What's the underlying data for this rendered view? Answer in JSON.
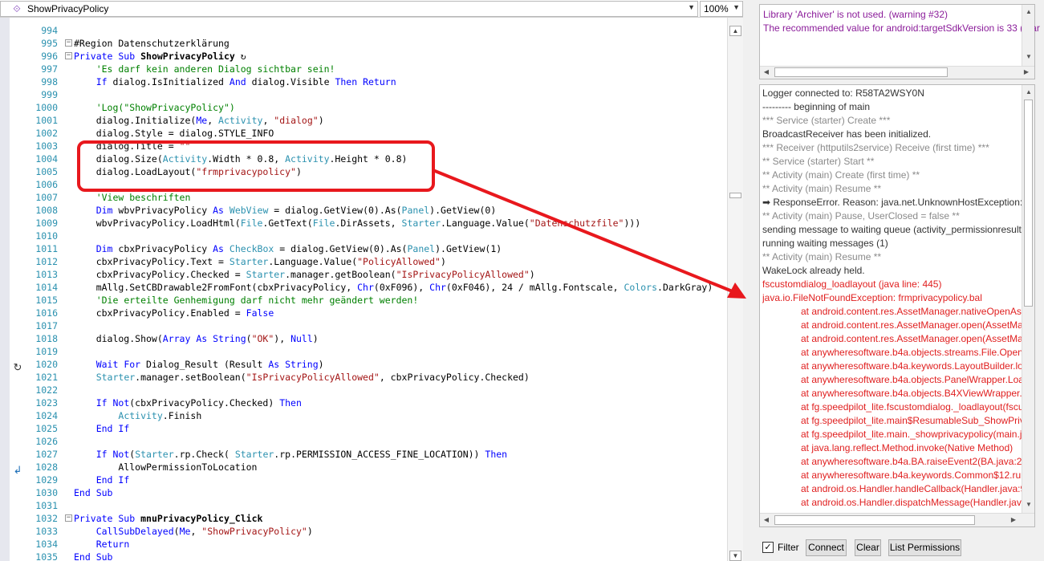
{
  "editor": {
    "sub_selector": "ShowPrivacyPolicy",
    "zoom": "100%",
    "code_lines": [
      {
        "n": "994",
        "h": ""
      },
      {
        "n": "995",
        "h": "#Region Datenschutzerklärung"
      },
      {
        "n": "996",
        "h": "<span class=\"k\">Private Sub</span> <span class=\"b\">ShowPrivacyPolicy</span>"
      },
      {
        "n": "997",
        "h": "    <span class=\"c\">'Es darf kein anderen Dialog sichtbar sein!</span>"
      },
      {
        "n": "998",
        "h": "    <span class=\"k\">If</span> dialog.IsInitialized <span class=\"k\">And</span> dialog.Visible <span class=\"k\">Then Return</span>"
      },
      {
        "n": "999",
        "h": ""
      },
      {
        "n": "1000",
        "h": "    <span class=\"c\">'Log(\"ShowPrivacyPolicy\")</span>"
      },
      {
        "n": "1001",
        "h": "    dialog.Initialize(<span class=\"k\">Me</span>, <span class=\"t\">Activity</span>, <span class=\"s\">\"dialog\"</span>)"
      },
      {
        "n": "1002",
        "h": "    dialog.Style = dialog.STYLE_INFO"
      },
      {
        "n": "1003",
        "h": "    dialog.Title = <span class=\"s\">\"\"</span>"
      },
      {
        "n": "1004",
        "h": "    dialog.Size(<span class=\"t\">Activity</span>.Width * 0.8, <span class=\"t\">Activity</span>.Height * 0.8)"
      },
      {
        "n": "1005",
        "h": "    dialog.LoadLayout(<span class=\"s\">\"frmprivacypolicy\"</span>)"
      },
      {
        "n": "1006",
        "h": ""
      },
      {
        "n": "1007",
        "h": "    <span class=\"c\">'View beschriften</span>"
      },
      {
        "n": "1008",
        "h": "    <span class=\"k\">Dim</span> wbvPrivacyPolicy <span class=\"k\">As</span> <span class=\"t\">WebView</span> = dialog.GetView(0).As(<span class=\"t\">Panel</span>).GetView(0)"
      },
      {
        "n": "1009",
        "h": "    wbvPrivacyPolicy.LoadHtml(<span class=\"t\">File</span>.GetText(<span class=\"t\">File</span>.DirAssets, <span class=\"t\">Starter</span>.Language.Value(<span class=\"s\">\"Datenschutzfile\"</span>)))"
      },
      {
        "n": "1010",
        "h": ""
      },
      {
        "n": "1011",
        "h": "    <span class=\"k\">Dim</span> cbxPrivacyPolicy <span class=\"k\">As</span> <span class=\"t\">CheckBox</span> = dialog.GetView(0).As(<span class=\"t\">Panel</span>).GetView(1)"
      },
      {
        "n": "1012",
        "h": "    cbxPrivacyPolicy.Text = <span class=\"t\">Starter</span>.Language.Value(<span class=\"s\">\"PolicyAllowed\"</span>)"
      },
      {
        "n": "1013",
        "h": "    cbxPrivacyPolicy.Checked = <span class=\"t\">Starter</span>.manager.getBoolean(<span class=\"s\">\"IsPrivacyPolicyAllowed\"</span>)"
      },
      {
        "n": "1014",
        "h": "    mAllg.SetCBDrawable2FromFont(cbxPrivacyPolicy, <span class=\"k\">Chr</span>(0xF096), <span class=\"k\">Chr</span>(0xF046), 24 / mAllg.Fontscale, <span class=\"t\">Colors</span>.DarkGray)"
      },
      {
        "n": "1015",
        "h": "    <span class=\"c\">'Die erteilte Genhemigung darf nicht mehr geändert werden!</span>"
      },
      {
        "n": "1016",
        "h": "    cbxPrivacyPolicy.Enabled = <span class=\"k\">False</span>"
      },
      {
        "n": "1017",
        "h": ""
      },
      {
        "n": "1018",
        "h": "    dialog.Show(<span class=\"k\">Array As String</span>(<span class=\"s\">\"OK\"</span>), <span class=\"k\">Null</span>)"
      },
      {
        "n": "1019",
        "h": ""
      },
      {
        "n": "1020",
        "h": "    <span class=\"k\">Wait For</span> Dialog_Result (Result <span class=\"k\">As String</span>)"
      },
      {
        "n": "1021",
        "h": "    <span class=\"t\">Starter</span>.manager.setBoolean(<span class=\"s\">\"IsPrivacyPolicyAllowed\"</span>, cbxPrivacyPolicy.Checked)"
      },
      {
        "n": "1022",
        "h": ""
      },
      {
        "n": "1023",
        "h": "    <span class=\"k\">If Not</span>(cbxPrivacyPolicy.Checked) <span class=\"k\">Then</span>"
      },
      {
        "n": "1024",
        "h": "        <span class=\"t\">Activity</span>.Finish"
      },
      {
        "n": "1025",
        "h": "    <span class=\"k\">End If</span>"
      },
      {
        "n": "1026",
        "h": ""
      },
      {
        "n": "1027",
        "h": "    <span class=\"k\">If Not</span>(<span class=\"t\">Starter</span>.rp.Check( <span class=\"t\">Starter</span>.rp.PERMISSION_ACCESS_FINE_LOCATION)) <span class=\"k\">Then</span>"
      },
      {
        "n": "1028",
        "h": "        AllowPermissionToLocation"
      },
      {
        "n": "1029",
        "h": "    <span class=\"k\">End If</span>"
      },
      {
        "n": "1030",
        "h": "<span class=\"k\">End Sub</span>"
      },
      {
        "n": "1031",
        "h": ""
      },
      {
        "n": "1032",
        "h": "<span class=\"k\">Private Sub</span> <span class=\"b\">mnuPrivacyPolicy_Click</span>"
      },
      {
        "n": "1033",
        "h": "    <span class=\"k\">CallSubDelayed</span>(<span class=\"k\">Me</span>, <span class=\"s\">\"ShowPrivacyPolicy\"</span>)"
      },
      {
        "n": "1034",
        "h": "    <span class=\"k\">Return</span>"
      },
      {
        "n": "1035",
        "h": "<span class=\"k\">End Sub</span>"
      }
    ]
  },
  "warnings": {
    "line1": "Library 'Archiver' is not used. (warning #32)",
    "line2": "The recommended value for android:targetSdkVersion is 33 (mar"
  },
  "logs": {
    "lines": [
      {
        "cls": "dark",
        "t": "Logger connected to:  R58TA2WSY0N"
      },
      {
        "cls": "dark",
        "t": "--------- beginning of main"
      },
      {
        "cls": "gray",
        "t": "*** Service (starter) Create ***"
      },
      {
        "cls": "dark",
        "t": "BroadcastReceiver has been initialized."
      },
      {
        "cls": "gray",
        "t": "*** Receiver (httputils2service) Receive (first time) ***"
      },
      {
        "cls": "gray",
        "t": "** Service (starter) Start **"
      },
      {
        "cls": "gray",
        "t": "** Activity (main) Create (first time) **"
      },
      {
        "cls": "gray",
        "t": "** Activity (main) Resume **"
      },
      {
        "cls": "dark",
        "t": "ResponseError. Reason: java.net.UnknownHostException:",
        "icon": true
      },
      {
        "cls": "gray",
        "t": "** Activity (main) Pause, UserClosed = false **"
      },
      {
        "cls": "dark",
        "t": "sending message to waiting queue (activity_permissionresult)"
      },
      {
        "cls": "dark",
        "t": "running waiting messages (1)"
      },
      {
        "cls": "gray",
        "t": "** Activity (main) Resume **"
      },
      {
        "cls": "dark",
        "t": "WakeLock already held."
      },
      {
        "cls": "red",
        "t": "fscustomdialog_loadlayout (java line: 445)"
      },
      {
        "cls": "red",
        "t": "java.io.FileNotFoundException: frmprivacypolicy.bal"
      },
      {
        "cls": "red ind",
        "t": "at android.content.res.AssetManager.nativeOpenAsset"
      },
      {
        "cls": "red ind",
        "t": "at android.content.res.AssetManager.open(AssetMan"
      },
      {
        "cls": "red ind",
        "t": "at android.content.res.AssetManager.open(AssetMan"
      },
      {
        "cls": "red ind",
        "t": "at anywheresoftware.b4a.objects.streams.File.OpenIn"
      },
      {
        "cls": "red ind",
        "t": "at anywheresoftware.b4a.keywords.LayoutBuilder.loa"
      },
      {
        "cls": "red ind",
        "t": "at anywheresoftware.b4a.objects.PanelWrapper.Load"
      },
      {
        "cls": "red ind",
        "t": "at anywheresoftware.b4a.objects.B4XViewWrapper.L"
      },
      {
        "cls": "red ind",
        "t": "at fg.speedpilot_lite.fscustomdialog._loadlayout(fscu"
      },
      {
        "cls": "red ind",
        "t": "at fg.speedpilot_lite.main$ResumableSub_ShowPriva"
      },
      {
        "cls": "red ind",
        "t": "at fg.speedpilot_lite.main._showprivacypolicy(main.j"
      },
      {
        "cls": "red ind",
        "t": "at java.lang.reflect.Method.invoke(Native Method)"
      },
      {
        "cls": "red ind",
        "t": "at anywheresoftware.b4a.BA.raiseEvent2(BA.java:221"
      },
      {
        "cls": "red ind",
        "t": "at anywheresoftware.b4a.keywords.Common$12.run"
      },
      {
        "cls": "red ind",
        "t": "at android.os.Handler.handleCallback(Handler.java:9"
      },
      {
        "cls": "red ind",
        "t": "at android.os.Handler.dispatchMessage(Handler.java"
      }
    ]
  },
  "toolbar": {
    "filter_label": "Filter",
    "filter_checked": "✓",
    "connect_label": "Connect",
    "clear_label": "Clear",
    "list_permissions_label": "List Permissions"
  },
  "colors": {
    "annotation": "#e8181d",
    "warning_text": "#8b1d9a",
    "error_text": "#e01f1f"
  }
}
